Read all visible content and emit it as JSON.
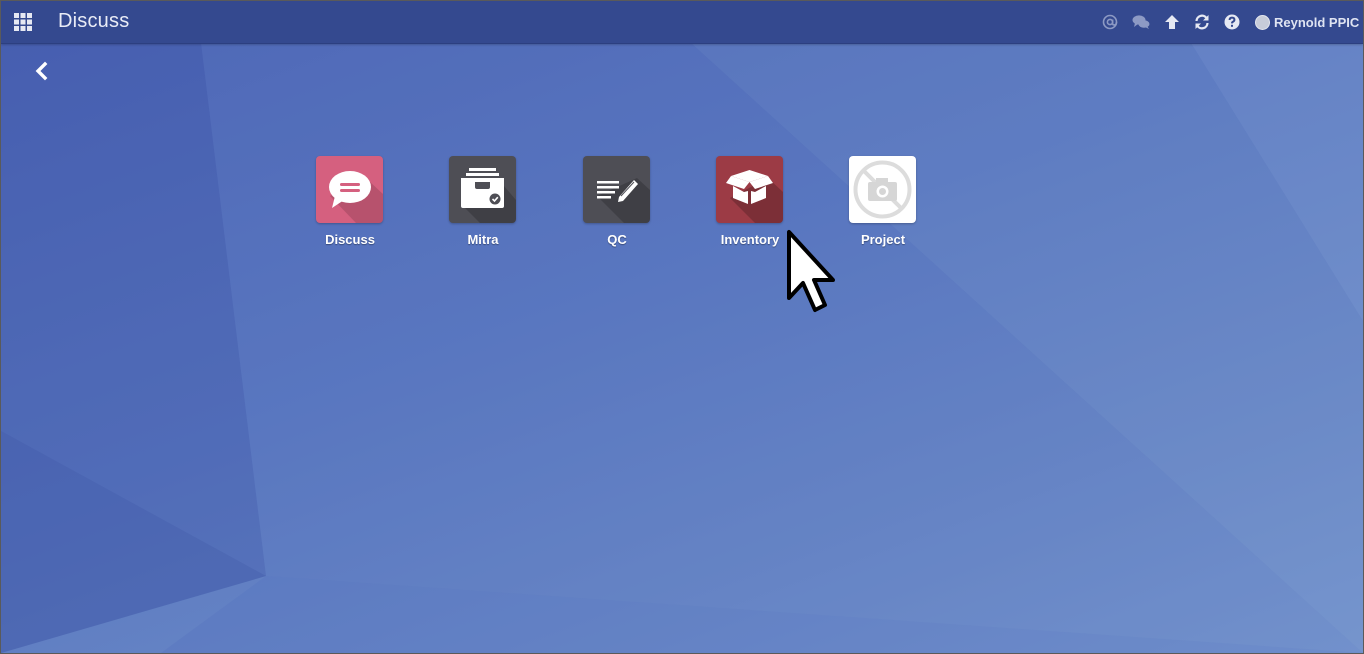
{
  "header": {
    "title": "Discuss",
    "user_name": "Reynold PPIC",
    "icons": [
      "apps-grid-icon",
      "at-mention-icon",
      "chat-bubbles-icon",
      "arrow-up-icon",
      "refresh-icon",
      "help-icon"
    ]
  },
  "apps": [
    {
      "label": "Discuss",
      "icon": "speech-bubble-icon",
      "color": "#d5607f"
    },
    {
      "label": "Mitra",
      "icon": "inbox-tray-icon",
      "color": "#4e4e55"
    },
    {
      "label": "QC",
      "icon": "document-pencil-icon",
      "color": "#4e4e55"
    },
    {
      "label": "Inventory",
      "icon": "open-box-icon",
      "color": "#9c3b45"
    },
    {
      "label": "Project",
      "icon": "no-camera-icon",
      "color": "#ffffff"
    }
  ],
  "colors": {
    "topbar": "#34498f",
    "background": "#5a78c0"
  }
}
